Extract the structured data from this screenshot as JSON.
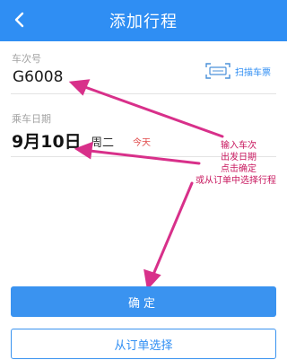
{
  "header": {
    "title": "添加行程",
    "back_icon": "chevron-left-icon"
  },
  "train": {
    "label": "车次号",
    "value": "G6008",
    "scan_label": "扫描车票",
    "scan_icon": "ticket-scan-icon"
  },
  "date": {
    "label": "乘车日期",
    "value": "9月10日",
    "weekday": "周二",
    "today": "今天"
  },
  "annotations": [
    "输入车次",
    "出发日期",
    "点击确定",
    "或从订单中选择行程"
  ],
  "buttons": {
    "confirm": "确定",
    "from_order": "从订单选择"
  },
  "colors": {
    "header": "#2f8ef3",
    "accent": "#3a93f0",
    "annotation": "#c8185f",
    "today": "#e04a4a"
  }
}
